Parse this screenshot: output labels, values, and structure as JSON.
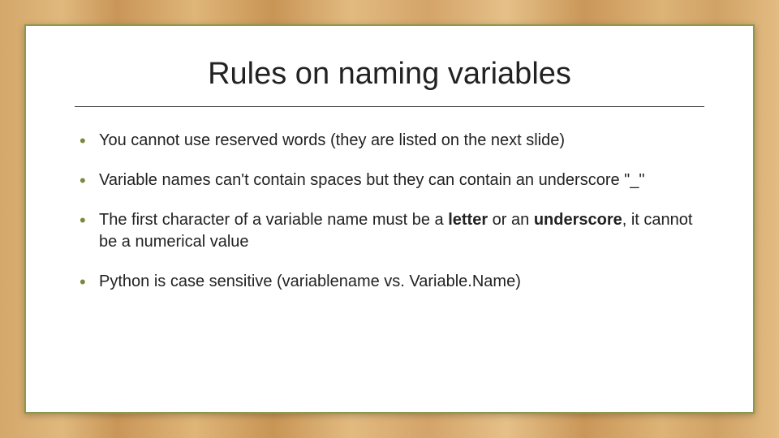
{
  "slide": {
    "title": "Rules on naming variables",
    "bullets": [
      {
        "html": "You cannot use reserved words (they are listed on the next slide)"
      },
      {
        "html": "Variable names can't contain spaces but they can contain an underscore \"_\""
      },
      {
        "html": "The first character of a variable name must be a <span class=\"bold\">letter</span> or an <span class=\"bold\">underscore</span>, it cannot be a numerical value"
      },
      {
        "html": "Python is case sensitive (variablename vs. Variable.Name)"
      }
    ]
  }
}
